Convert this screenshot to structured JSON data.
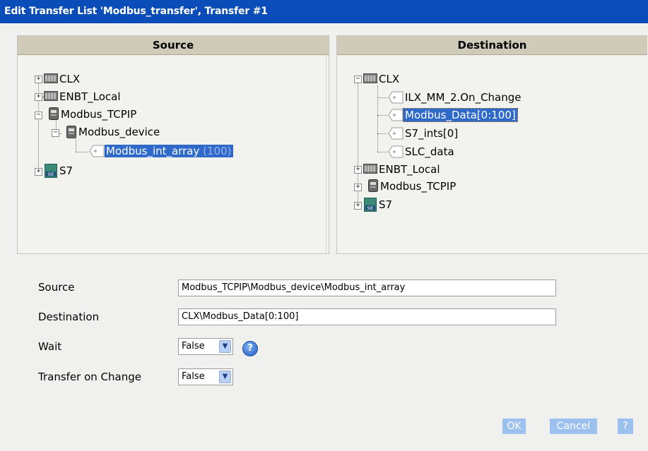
{
  "window": {
    "title": "Edit Transfer List 'Modbus_transfer', Transfer #1"
  },
  "source_panel": {
    "header": "Source",
    "tree": {
      "clx": "CLX",
      "enbt": "ENBT_Local",
      "modbus_tcpip": "Modbus_TCPIP",
      "modbus_device": "Modbus_device",
      "modbus_int_array": "Modbus_int_array",
      "modbus_int_array_count": "(100)",
      "s7": "S7"
    }
  },
  "destination_panel": {
    "header": "Destination",
    "tree": {
      "clx": "CLX",
      "ilx": "ILX_MM_2.On_Change",
      "modbus_data": "Modbus_Data[0:100]",
      "s7_ints": "S7_ints[0]",
      "slc_data": "SLC_data",
      "enbt": "ENBT_Local",
      "modbus_tcpip": "Modbus_TCPIP",
      "s7": "S7"
    }
  },
  "form": {
    "source_label": "Source",
    "source_value": "Modbus_TCPIP\\Modbus_device\\Modbus_int_array",
    "destination_label": "Destination",
    "destination_value": "CLX\\Modbus_Data[0:100]",
    "wait_label": "Wait",
    "wait_value": "False",
    "transfer_on_change_label": "Transfer on Change",
    "transfer_on_change_value": "False",
    "help_glyph": "?"
  },
  "buttons": {
    "ok": "OK",
    "cancel": "Cancel",
    "help": "?"
  },
  "colors": {
    "titlebar": "#0a4db8",
    "selection": "#2f6acb",
    "button": "#9dc1ee"
  }
}
